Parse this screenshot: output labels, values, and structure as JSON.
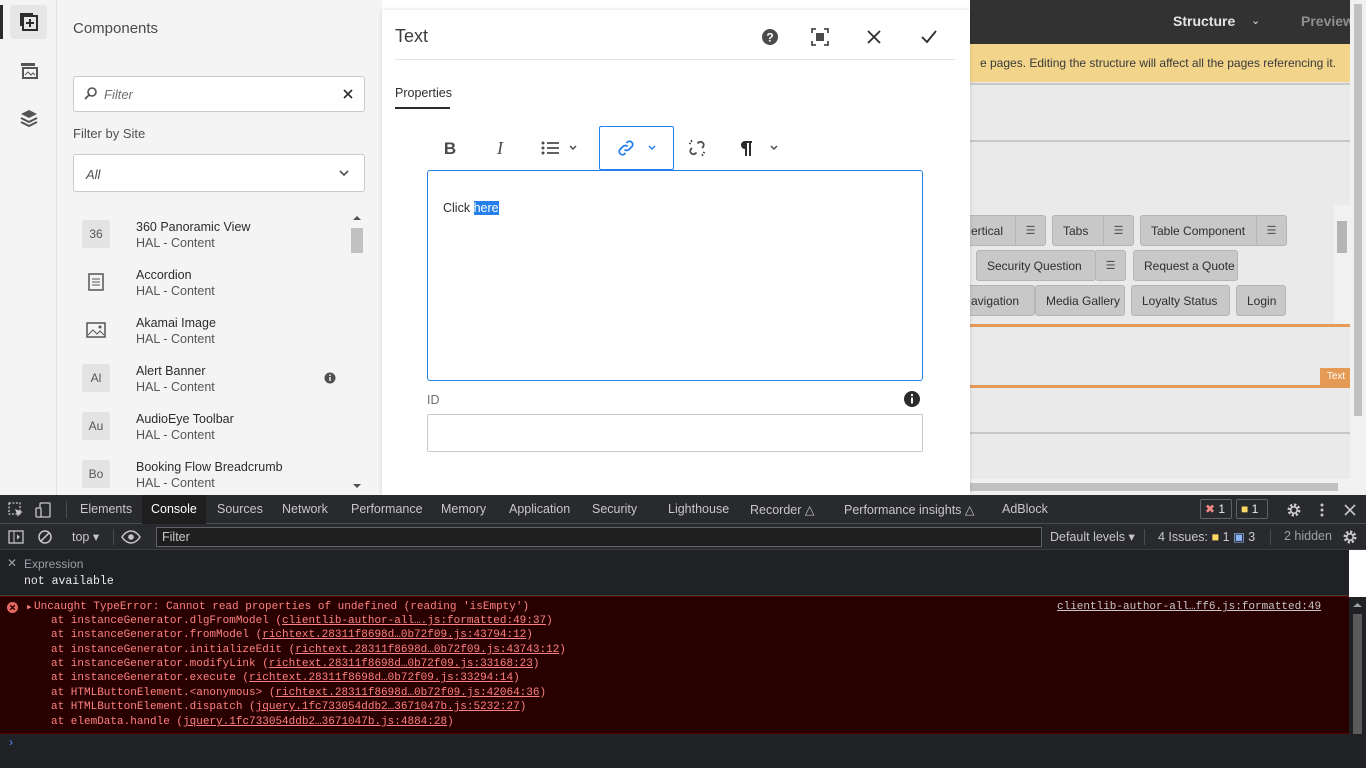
{
  "page": {
    "structure_label": "Structure",
    "preview_label": "Preview",
    "warning_text": "e pages. Editing the structure will affect all the pages referencing it.",
    "components": [
      {
        "label": "ertical"
      },
      {
        "label": "Tabs"
      },
      {
        "label": "Table Component"
      },
      {
        "label": "Security Question"
      },
      {
        "label": "Request a Quote"
      },
      {
        "label": "avigation"
      },
      {
        "label": "Media Gallery"
      },
      {
        "label": "Loyalty Status"
      },
      {
        "label": "Login"
      }
    ],
    "text_badge": "Text"
  },
  "components_panel": {
    "title": "Components",
    "filter_placeholder": "Filter",
    "filter_by_site_label": "Filter by Site",
    "site_selected": "All",
    "items": [
      {
        "icon": "36",
        "name": "360 Panoramic View",
        "group": "HAL - Content"
      },
      {
        "icon": "accordion-icon",
        "name": "Accordion",
        "group": "HAL - Content"
      },
      {
        "icon": "image-icon",
        "name": "Akamai Image",
        "group": "HAL - Content"
      },
      {
        "icon": "Al",
        "name": "Alert Banner",
        "group": "HAL - Content"
      },
      {
        "icon": "Au",
        "name": "AudioEye Toolbar",
        "group": "HAL - Content"
      },
      {
        "icon": "Bo",
        "name": "Booking Flow Breadcrumb",
        "group": "HAL - Content"
      }
    ]
  },
  "dialog": {
    "title": "Text",
    "tab_properties": "Properties",
    "rte_text_before": "Click ",
    "rte_text_selected": "here",
    "id_label": "ID",
    "id_value": ""
  },
  "devtools": {
    "tabs": [
      "Elements",
      "Console",
      "Sources",
      "Network",
      "Performance",
      "Memory",
      "Application",
      "Security",
      "Lighthouse",
      "Recorder",
      "Performance insights",
      "AdBlock"
    ],
    "error_count": "1",
    "warning_count": "1",
    "context": "top",
    "filter_placeholder": "Filter",
    "levels": "Default levels",
    "issues_label": "4 Issues:",
    "issues_warn": "1",
    "issues_info": "3",
    "hidden": "2 hidden",
    "expression_label": "Expression",
    "expression_value": "not available",
    "error_message": "Uncaught TypeError: Cannot read properties of undefined (reading 'isEmpty')",
    "error_source": "clientlib-author-all…ff6.js:formatted:49",
    "stack": [
      {
        "fn": "at instanceGenerator.dlgFromModel (",
        "loc": "clientlib-author-all….js:formatted:49:37",
        "end": ")"
      },
      {
        "fn": "at instanceGenerator.fromModel (",
        "loc": "richtext.28311f8698d…0b72f09.js:43794:12",
        "end": ")"
      },
      {
        "fn": "at instanceGenerator.initializeEdit (",
        "loc": "richtext.28311f8698d…0b72f09.js:43743:12",
        "end": ")"
      },
      {
        "fn": "at instanceGenerator.modifyLink (",
        "loc": "richtext.28311f8698d…0b72f09.js:33168:23",
        "end": ")"
      },
      {
        "fn": "at instanceGenerator.execute (",
        "loc": "richtext.28311f8698d…0b72f09.js:33294:14",
        "end": ")"
      },
      {
        "fn": "at HTMLButtonElement.<anonymous> (",
        "loc": "richtext.28311f8698d…0b72f09.js:42064:36",
        "end": ")"
      },
      {
        "fn": "at HTMLButtonElement.dispatch (",
        "loc": "jquery.1fc733054ddb2…3671047b.js:5232:27",
        "end": ")"
      },
      {
        "fn": "at elemData.handle (",
        "loc": "jquery.1fc733054ddb2…3671047b.js:4884:28",
        "end": ")"
      }
    ]
  },
  "colors": {
    "accent": "#2680eb",
    "warning_bar": "#f2d58b",
    "console_error_bg": "#290000",
    "console_error_text": "#ff8080"
  }
}
